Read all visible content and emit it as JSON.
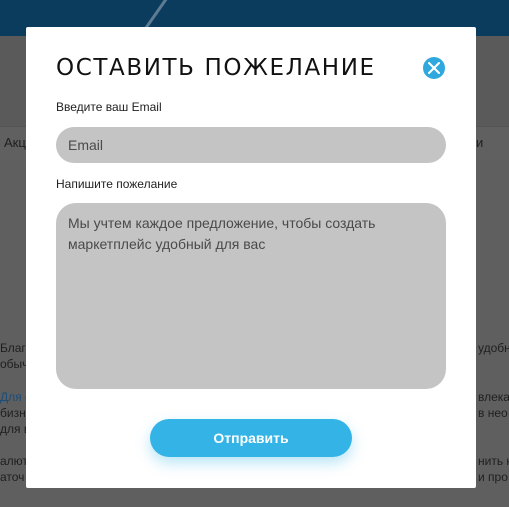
{
  "background": {
    "nav_left": "Акц",
    "nav_right": "и",
    "left_lines": [
      "Благ",
      "обыч",
      "Для с",
      "бизн",
      "для в",
      "алют",
      "аточ"
    ],
    "right_lines": [
      "удобн",
      "влека",
      "в нео",
      "нить к",
      "и про"
    ]
  },
  "modal": {
    "title": "ОСТАВИТЬ ПОЖЕЛАНИЕ",
    "close_icon": "close-icon",
    "email_label": "Введите ваш Email",
    "email_placeholder": "Email",
    "wish_label": "Напишите пожелание",
    "wish_placeholder": "Мы учтем каждое предложение, чтобы создать маркетплейс удобный для вас",
    "submit_label": "Отправить"
  },
  "colors": {
    "accent": "#34b4e6",
    "close_button": "#2fa9dd",
    "input_background": "#c4c4c4"
  }
}
